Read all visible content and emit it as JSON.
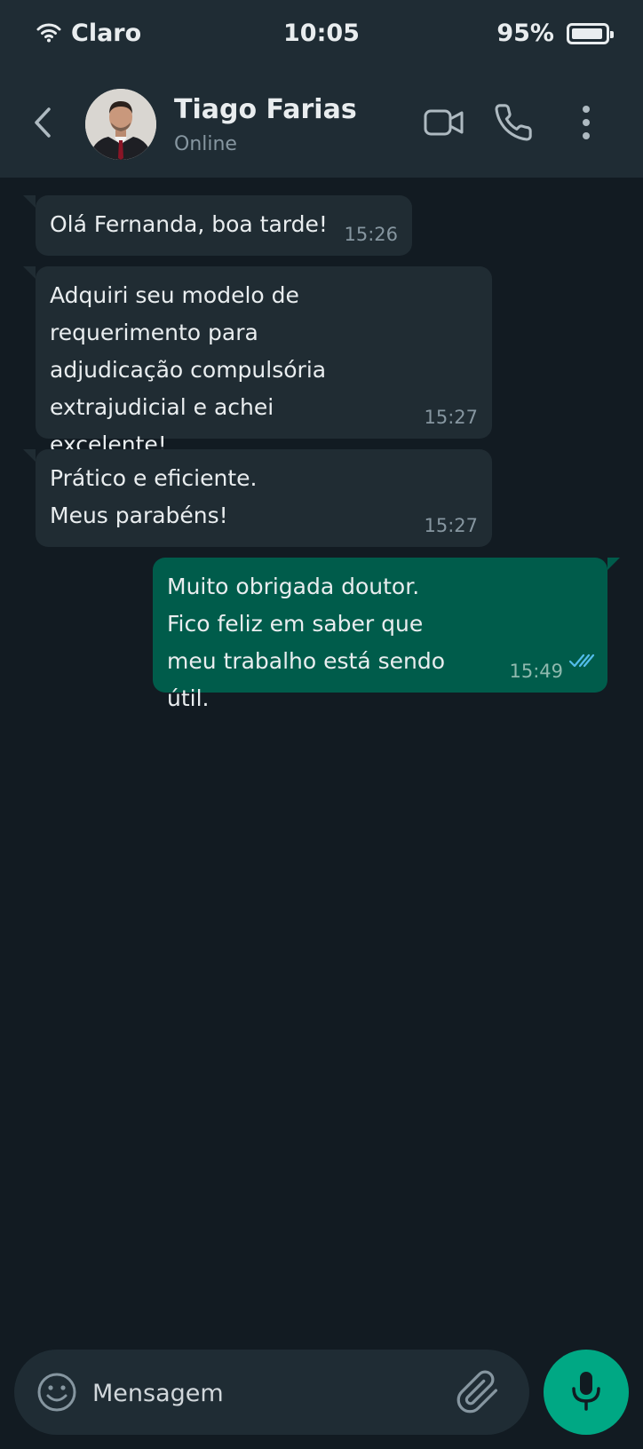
{
  "status_bar": {
    "carrier": "Claro",
    "time": "10:05",
    "battery": "95%",
    "battery_level": 0.95
  },
  "header": {
    "name": "Tiago Farias",
    "status": "Online"
  },
  "messages": [
    {
      "direction": "in",
      "text": "Olá Fernanda, boa tarde!",
      "time": "15:26"
    },
    {
      "direction": "in",
      "text": "Adquiri seu modelo de requerimento para adjudicação compulsória extrajudicial e achei excelente!",
      "time": "15:27"
    },
    {
      "direction": "in",
      "text": "Prático e eficiente. Meus parabéns!",
      "time": "15:27"
    },
    {
      "direction": "out",
      "text": "Muito obrigada doutor. Fico feliz em saber que meu trabalho está sendo útil.",
      "time": "15:49",
      "status": "read"
    }
  ],
  "composer": {
    "placeholder": "Mensagem"
  },
  "icons": [
    "wifi-icon",
    "battery-icon",
    "back-icon",
    "video-call-icon",
    "phone-icon",
    "more-options-icon",
    "emoji-icon",
    "attach-icon",
    "mic-icon",
    "double-check-icon"
  ],
  "colors": {
    "background": "#121b22",
    "header": "#1f2c34",
    "incoming_bubble": "#202c33",
    "outgoing_bubble": "#005c4b",
    "accent": "#00a884",
    "read_ticks": "#53bdeb"
  }
}
